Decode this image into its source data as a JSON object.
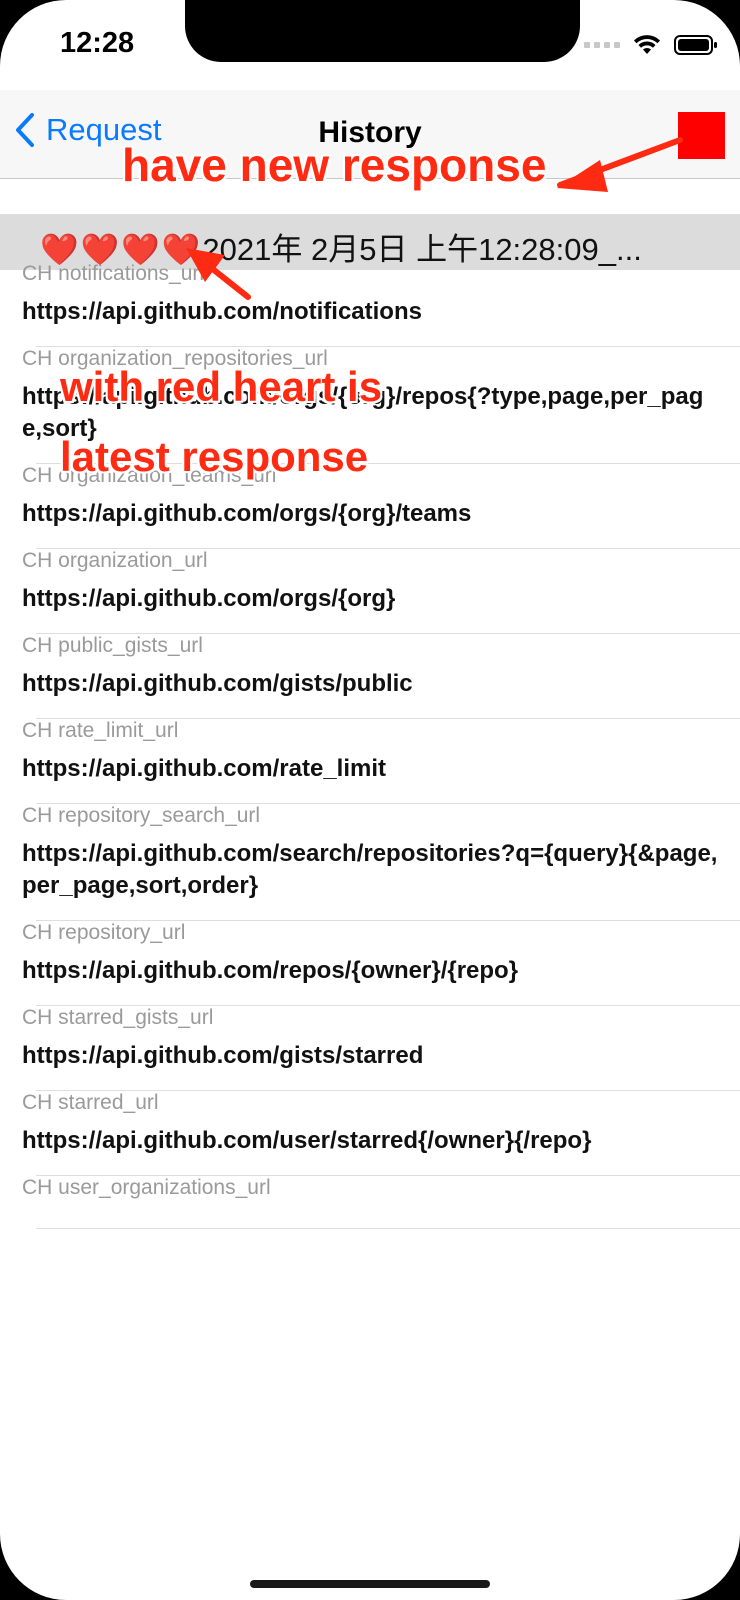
{
  "status_bar": {
    "time": "12:28"
  },
  "navbar": {
    "back_label": "Request",
    "title": "History"
  },
  "section": {
    "hearts": "❤️❤️❤️❤️",
    "title": "2021年 2月5日 上午12:28:09_..."
  },
  "rows": [
    {
      "key": "CH notifications_url",
      "value": "https://api.github.com/notifications"
    },
    {
      "key": "CH organization_repositories_url",
      "value": "https://api.github.com/orgs/{org}/repos{?type,page,per_page,sort}"
    },
    {
      "key": "CH organization_teams_url",
      "value": "https://api.github.com/orgs/{org}/teams"
    },
    {
      "key": "CH organization_url",
      "value": "https://api.github.com/orgs/{org}"
    },
    {
      "key": "CH public_gists_url",
      "value": "https://api.github.com/gists/public"
    },
    {
      "key": "CH rate_limit_url",
      "value": "https://api.github.com/rate_limit"
    },
    {
      "key": "CH repository_search_url",
      "value": "https://api.github.com/search/repositories?q={query}{&page,per_page,sort,order}"
    },
    {
      "key": "CH repository_url",
      "value": "https://api.github.com/repos/{owner}/{repo}"
    },
    {
      "key": "CH starred_gists_url",
      "value": "https://api.github.com/gists/starred"
    },
    {
      "key": "CH starred_url",
      "value": "https://api.github.com/user/starred{/owner}{/repo}"
    },
    {
      "key": "CH user_organizations_url",
      "value": ""
    }
  ],
  "annotations": {
    "new_response": "have new response",
    "red_heart_line1": "with red heart is",
    "red_heart_line2": "latest response"
  },
  "colors": {
    "accent": "#0a7aff",
    "annotation": "#ff2a12",
    "indicator": "#ff0000"
  }
}
